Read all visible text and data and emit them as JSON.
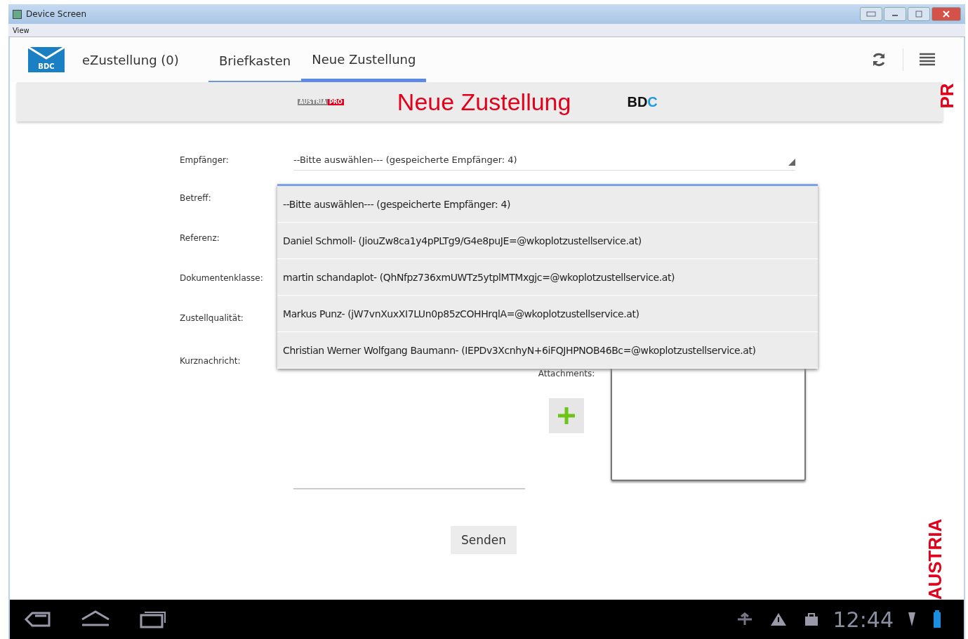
{
  "window": {
    "title": "Device Screen"
  },
  "menu": [
    "View"
  ],
  "app": {
    "logo_text": "BDC",
    "title": "eZustellung (0)",
    "tabs": [
      {
        "label": "Briefkasten",
        "selected": false
      },
      {
        "label": "Neue Zustellung",
        "selected": true
      }
    ]
  },
  "banner": {
    "left_logo": [
      {
        "text": "AUSTRIA",
        "color": "#8a8a8a"
      },
      {
        "text": "PRO",
        "color": "#e2001a"
      }
    ],
    "title": "Neue Zustellung",
    "right_logo": [
      {
        "text": "BD",
        "color": "#111111"
      },
      {
        "text": "C",
        "color": "#1e9be0"
      }
    ],
    "corner_text": "PR",
    "side_text": "AUSTRIA"
  },
  "form": {
    "fields": [
      {
        "label": "Empfänger:",
        "kind": "select",
        "value": "--Bitte auswählen--- (gespeicherte Empfänger: 4)"
      },
      {
        "label": "Betreff:"
      },
      {
        "label": "Referenz:"
      },
      {
        "label": "Dokumentenklasse:"
      },
      {
        "label": "Zustellqualität:"
      }
    ],
    "message": {
      "label": "Kurznachricht:"
    },
    "attachments": {
      "label": "Attachments:"
    },
    "send": "Senden"
  },
  "dropdown": {
    "options": [
      "--Bitte auswählen--- (gespeicherte Empfänger: 4)",
      "Daniel Schmoll- (JiouZw8ca1y4pPLTg9/G4e8puJE=@wkoplotzustellservice.at)",
      "martin schandaplot- (QhNfpz736xmUWTz5ytplMTMxgjc=@wkoplotzustellservice.at)",
      "Markus Punz- (jW7vnXuxXI7LUn0p85zCOHHrqlA=@wkoplotzustellservice.at)",
      "Christian Werner Wolfgang Baumann- (IEPDv3XcnhyN+6iFQJHPNOB46Bc=@wkoplotzustellservice.at)"
    ]
  },
  "status_bar": {
    "time": "12:44"
  }
}
